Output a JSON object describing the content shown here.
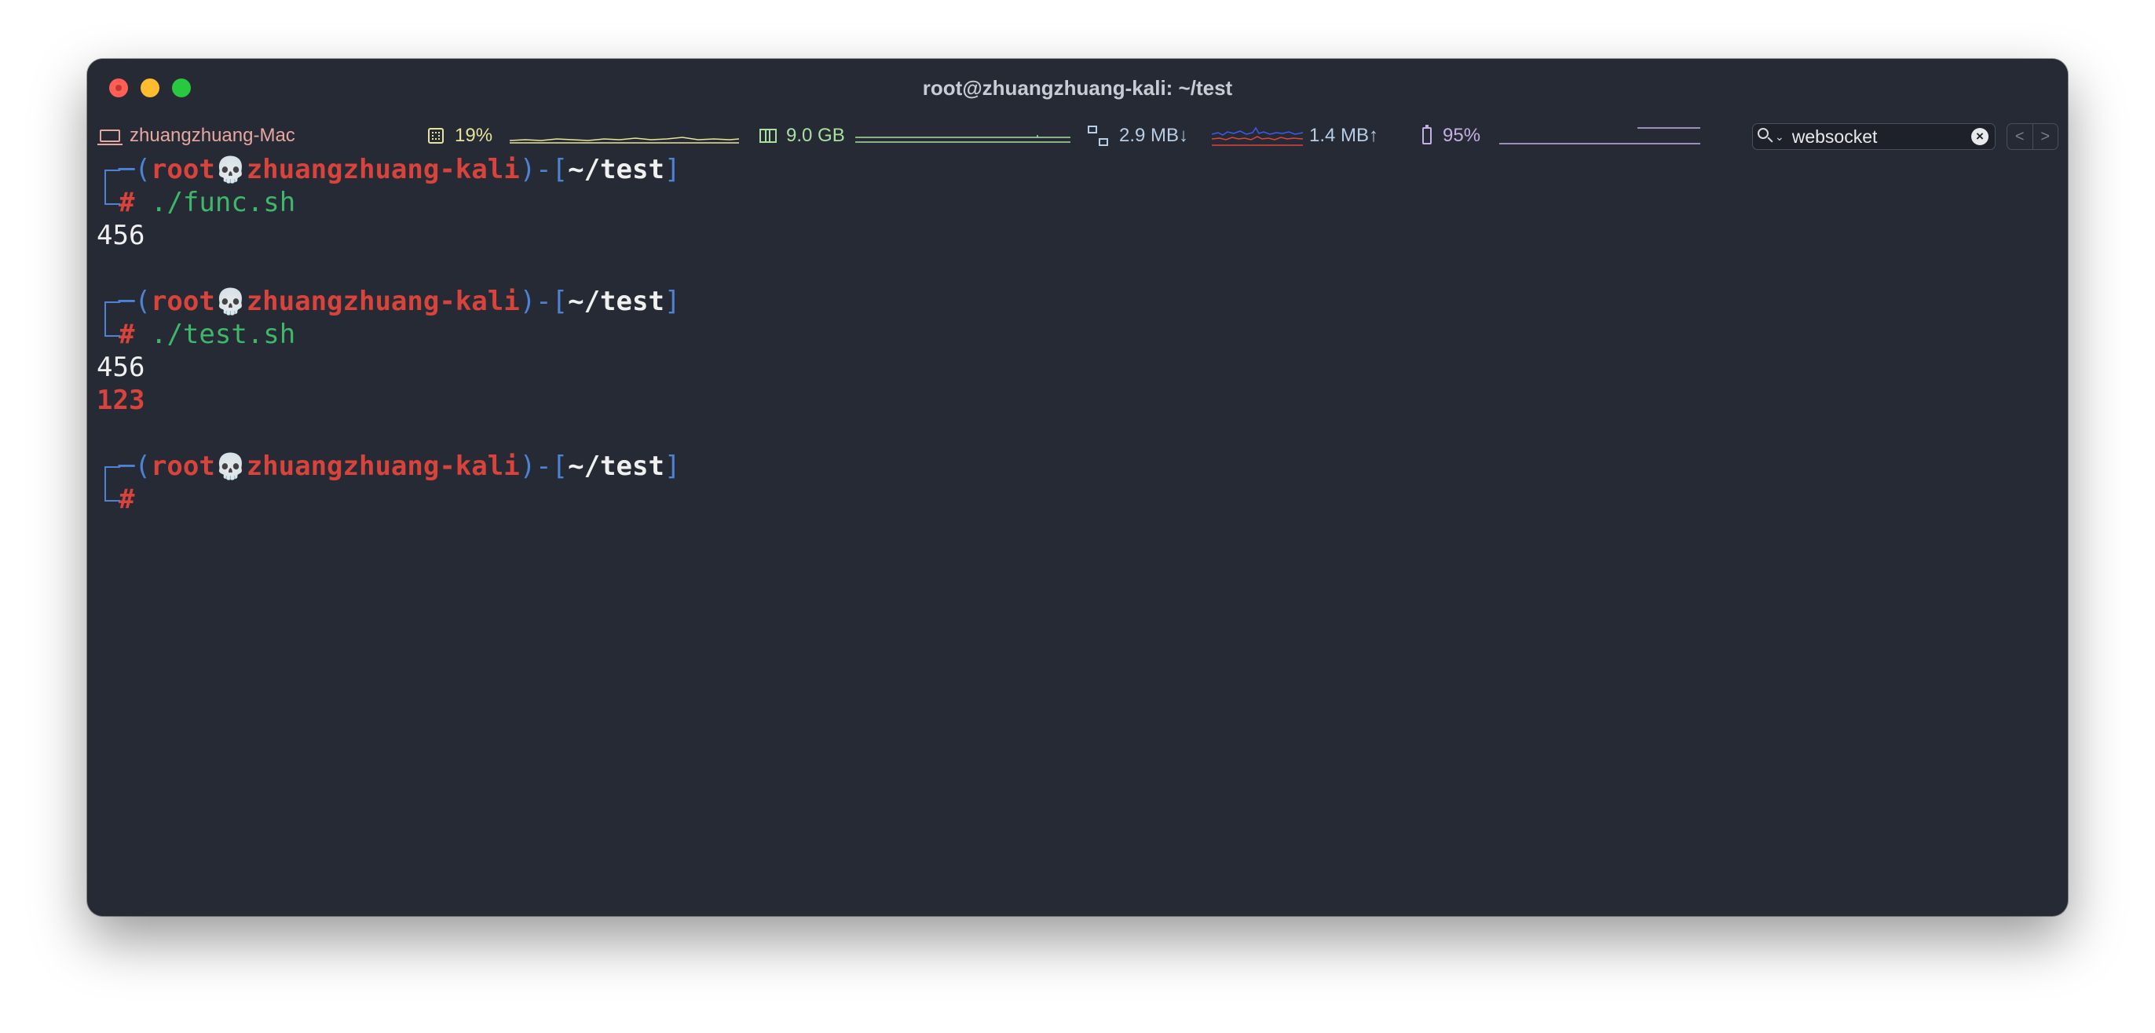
{
  "window": {
    "title": "root@zhuangzhuang-kali: ~/test"
  },
  "statusbar": {
    "host": "zhuangzhuang-Mac",
    "cpu": "19%",
    "memory": "9.0 GB",
    "net_down": "2.9 MB↓",
    "net_up": "1.4 MB↑",
    "battery": "95%"
  },
  "search": {
    "value": "websocket"
  },
  "nav": {
    "prev": "<",
    "next": ">"
  },
  "colors": {
    "background": "#262a34",
    "frame": "#4e82d4",
    "user_host": "#d8433b",
    "command": "#3fb76a",
    "output": "#f0f0f0"
  },
  "terminal": {
    "prompt_open": "─(",
    "prompt_close": ")-[",
    "prompt_end": "]",
    "user": "root",
    "skull": "💀",
    "host": "zhuangzhuang-kali",
    "cwd": "~/test",
    "hash": "#",
    "blocks": [
      {
        "command": "./func.sh",
        "output": [
          "456"
        ]
      },
      {
        "command": "./test.sh",
        "output": [
          "456"
        ],
        "error_output": [
          "123"
        ]
      },
      {
        "command": ""
      }
    ]
  }
}
